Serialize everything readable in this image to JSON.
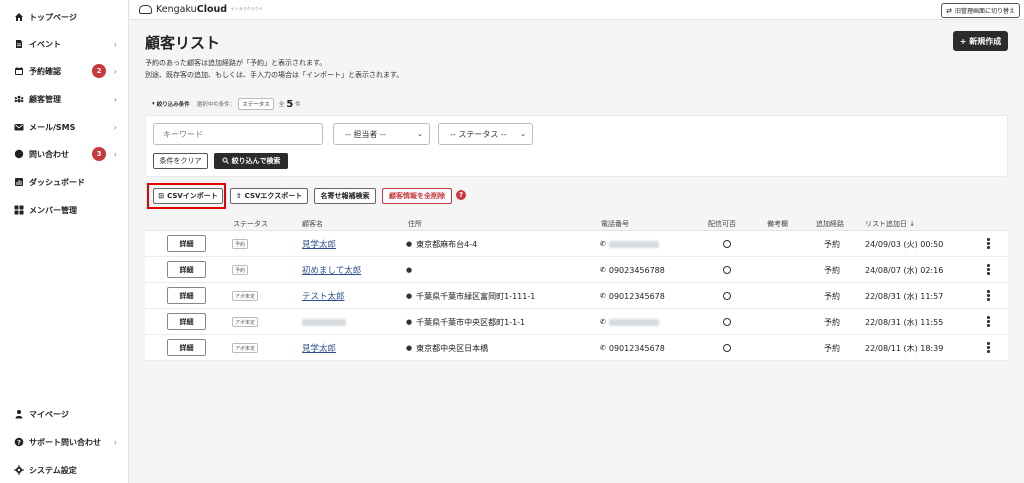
{
  "sidebar": {
    "top_items": [
      {
        "label": "トップページ",
        "icon": "home-icon",
        "chevron": false
      },
      {
        "label": "イベント",
        "icon": "document-icon",
        "chevron": true
      },
      {
        "label": "予約確認",
        "icon": "calendar-icon",
        "chevron": true,
        "badge": "2"
      },
      {
        "label": "顧客管理",
        "icon": "users-icon",
        "chevron": true
      },
      {
        "label": "メール/SMS",
        "icon": "mail-icon",
        "chevron": true
      },
      {
        "label": "問い合わせ",
        "icon": "chat-icon",
        "chevron": true,
        "badge": "3"
      },
      {
        "label": "ダッシュボード",
        "icon": "chart-icon",
        "chevron": false
      },
      {
        "label": "メンバー管理",
        "icon": "grid-icon",
        "chevron": false
      }
    ],
    "bottom_items": [
      {
        "label": "マイページ",
        "icon": "person-icon",
        "chevron": false
      },
      {
        "label": "サポート問い合わせ",
        "icon": "question-icon",
        "chevron": true
      },
      {
        "label": "システム設定",
        "icon": "gear-icon",
        "chevron": false
      }
    ]
  },
  "topbar": {
    "logo_prefix": "Kengaku",
    "logo_bold": "Cloud",
    "logo_sub": "ケンガククラウド",
    "switch_label": "旧管理画面に切り替え"
  },
  "page": {
    "title": "顧客リスト",
    "desc_line1": "予約のあった顧客は追加経路が「予約」と表示されます。",
    "desc_line2": "別途、既存客の追加、もしくは、手入力の場合は「インポート」と表示されます。",
    "new_button": "+ 新規作成"
  },
  "filter": {
    "title": "絞り込み条件",
    "selected_label": "選択中の条件：",
    "selected_tag": "ステータス",
    "total_prefix": "全",
    "total_count": "5",
    "total_suffix": "件",
    "keyword_placeholder": "キーワード",
    "assignee_select": "-- 担当者 --",
    "status_select": "-- ステータス --",
    "clear_button": "条件をクリア",
    "search_button": "絞り込んで検索"
  },
  "actions": {
    "csv_import": "CSVインポート",
    "csv_export": "CSVエクスポート",
    "name_search": "名寄せ報補検索",
    "delete_all": "顧客情報を全削除",
    "help": "?"
  },
  "table": {
    "headers": {
      "status": "ステータス",
      "name": "顧客名",
      "address": "住所",
      "phone": "電話番号",
      "deliverable": "配信可否",
      "notes": "備考欄",
      "route": "追加経路",
      "added": "リスト追加日 ↓"
    },
    "detail_label": "詳細",
    "rows": [
      {
        "status": "予約",
        "name": "見学太郎",
        "address": "東京都麻布台4-4",
        "phone": "",
        "deliverable": "○",
        "route": "予約",
        "added": "24/09/03 (火) 00:50"
      },
      {
        "status": "予約",
        "name": "初めまして太郎",
        "address": "",
        "phone": "09023456788",
        "deliverable": "○",
        "route": "予約",
        "added": "24/08/07 (水) 02:16"
      },
      {
        "status": "アポ未定",
        "name": "テスト太郎",
        "address": "千葉県千葉市緑区富岡町1-111-1",
        "phone": "09012345678",
        "deliverable": "○",
        "route": "予約",
        "added": "22/08/31 (水) 11:57"
      },
      {
        "status": "アポ未定",
        "name": "",
        "address": "千葉県千葉市中央区都町1-1-1",
        "phone": "",
        "deliverable": "○",
        "route": "予約",
        "added": "22/08/31 (水) 11:55"
      },
      {
        "status": "アポ未定",
        "name": "見学太郎",
        "address": "東京都中央区日本橋",
        "phone": "09012345678",
        "deliverable": "○",
        "route": "予約",
        "added": "22/08/11 (木) 18:39"
      }
    ]
  }
}
